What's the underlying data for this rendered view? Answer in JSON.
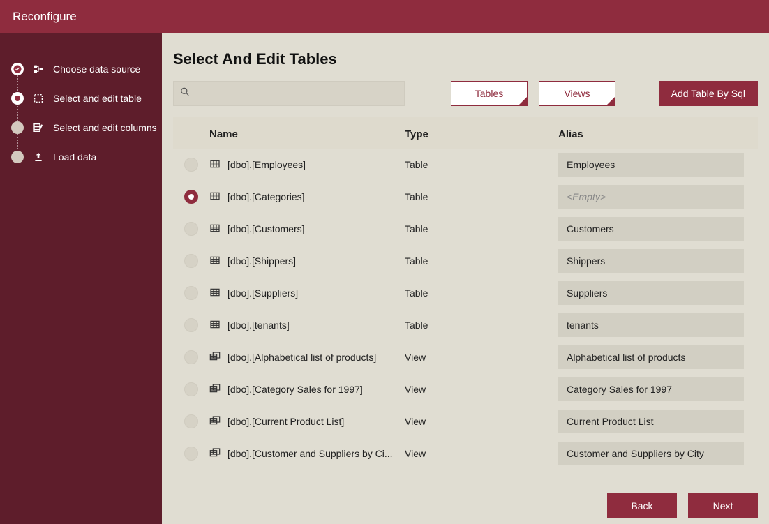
{
  "window_title": "Reconfigure",
  "sidebar": {
    "steps": [
      {
        "label": "Choose data source",
        "state": "completed",
        "icon": "datasource-icon"
      },
      {
        "label": "Select and edit table",
        "state": "active",
        "icon": "table-select-icon"
      },
      {
        "label": "Select and edit columns",
        "state": "pending",
        "icon": "columns-icon"
      },
      {
        "label": "Load data",
        "state": "pending",
        "icon": "upload-icon"
      }
    ]
  },
  "page": {
    "title": "Select And Edit Tables",
    "search_placeholder": "",
    "tables_btn": "Tables",
    "views_btn": "Views",
    "add_sql_btn": "Add Table By Sql"
  },
  "columns": {
    "name": "Name",
    "type": "Type",
    "alias": "Alias"
  },
  "empty_placeholder": "<Empty>",
  "rows": [
    {
      "name": "[dbo].[Employees]",
      "type": "Table",
      "alias": "Employees",
      "selected": false,
      "kind": "table"
    },
    {
      "name": "[dbo].[Categories]",
      "type": "Table",
      "alias": "",
      "selected": true,
      "kind": "table"
    },
    {
      "name": "[dbo].[Customers]",
      "type": "Table",
      "alias": "Customers",
      "selected": false,
      "kind": "table"
    },
    {
      "name": "[dbo].[Shippers]",
      "type": "Table",
      "alias": "Shippers",
      "selected": false,
      "kind": "table"
    },
    {
      "name": "[dbo].[Suppliers]",
      "type": "Table",
      "alias": "Suppliers",
      "selected": false,
      "kind": "table"
    },
    {
      "name": "[dbo].[tenants]",
      "type": "Table",
      "alias": "tenants",
      "selected": false,
      "kind": "table"
    },
    {
      "name": "[dbo].[Alphabetical list of products]",
      "type": "View",
      "alias": "Alphabetical list of products",
      "selected": false,
      "kind": "view"
    },
    {
      "name": "[dbo].[Category Sales for 1997]",
      "type": "View",
      "alias": "Category Sales for 1997",
      "selected": false,
      "kind": "view"
    },
    {
      "name": "[dbo].[Current Product List]",
      "type": "View",
      "alias": "Current Product List",
      "selected": false,
      "kind": "view"
    },
    {
      "name": "[dbo].[Customer and Suppliers by Ci...",
      "type": "View",
      "alias": "Customer and Suppliers by City",
      "selected": false,
      "kind": "view"
    }
  ],
  "footer": {
    "back": "Back",
    "next": "Next"
  },
  "colors": {
    "brand": "#8f2c3e",
    "sidebar": "#5e1d2b",
    "background": "#e0ddd2"
  }
}
